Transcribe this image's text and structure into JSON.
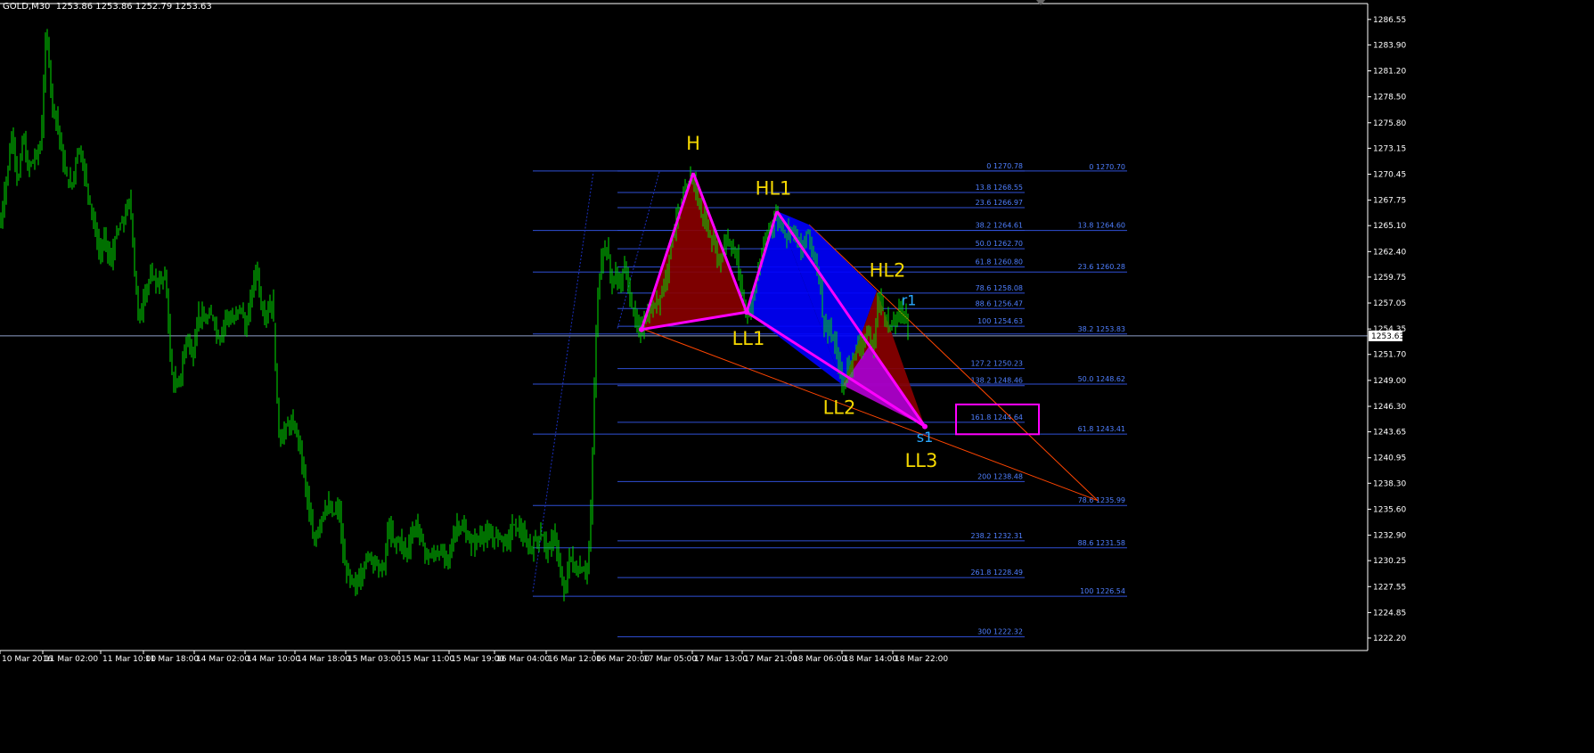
{
  "header": {
    "info": "GOLD,M30  1253.86 1253.86 1252.79 1253.63"
  },
  "colors": {
    "background": "#000000",
    "candle": "#00e000",
    "fib_line": "#2f4fd6",
    "fib_text": "#4f7fff",
    "pattern_line": "#ff00ff",
    "pattern_red": "#8b0000",
    "pattern_blue": "#0000ff",
    "label_yellow": "#f5d800",
    "label_cyan": "#2aa8ff",
    "trend_line": "#ff4500",
    "axis_text": "#ffffff"
  },
  "chart_data": {
    "type": "candlestick",
    "symbol": "GOLD",
    "timeframe": "M30",
    "current_price": "1253.63",
    "ylim": [
      1221.5,
      1288.5
    ],
    "y_ticks": [
      "1286.55",
      "1283.90",
      "1281.20",
      "1278.50",
      "1275.80",
      "1273.15",
      "1270.45",
      "1267.75",
      "1265.10",
      "1262.40",
      "1259.75",
      "1257.05",
      "1254.35",
      "1251.70",
      "1249.00",
      "1246.30",
      "1243.65",
      "1240.95",
      "1238.30",
      "1235.60",
      "1232.90",
      "1230.25",
      "1227.55",
      "1224.85",
      "1222.20"
    ],
    "x_ticks": [
      "10 Mar 2016",
      "11 Mar 02:00",
      "11 Mar 10:00",
      "11 Mar 18:00",
      "14 Mar 02:00",
      "14 Mar 10:00",
      "14 Mar 18:00",
      "15 Mar 03:00",
      "15 Mar 11:00",
      "15 Mar 19:00",
      "16 Mar 04:00",
      "16 Mar 12:00",
      "16 Mar 20:00",
      "17 Mar 05:00",
      "17 Mar 13:00",
      "17 Mar 21:00",
      "18 Mar 06:00",
      "18 Mar 14:00",
      "18 Mar 22:00"
    ],
    "price_path": [
      [
        0,
        1265.0
      ],
      [
        8,
        1270.5
      ],
      [
        14,
        1275.0
      ],
      [
        20,
        1269.0
      ],
      [
        26,
        1275.0
      ],
      [
        30,
        1271.0
      ],
      [
        38,
        1272.0
      ],
      [
        46,
        1273.5
      ],
      [
        52,
        1286.0
      ],
      [
        58,
        1278.0
      ],
      [
        64,
        1276.0
      ],
      [
        72,
        1271.0
      ],
      [
        80,
        1269.0
      ],
      [
        88,
        1273.5
      ],
      [
        94,
        1271.0
      ],
      [
        100,
        1268.0
      ],
      [
        106,
        1265.0
      ],
      [
        112,
        1262.0
      ],
      [
        118,
        1264.0
      ],
      [
        124,
        1261.0
      ],
      [
        130,
        1264.0
      ],
      [
        140,
        1266.0
      ],
      [
        146,
        1268.0
      ],
      [
        152,
        1259.0
      ],
      [
        156,
        1255.0
      ],
      [
        162,
        1258.0
      ],
      [
        170,
        1260.0
      ],
      [
        178,
        1259.0
      ],
      [
        186,
        1260.0
      ],
      [
        192,
        1250.0
      ],
      [
        198,
        1248.0
      ],
      [
        204,
        1250.0
      ],
      [
        210,
        1254.0
      ],
      [
        216,
        1251.0
      ],
      [
        222,
        1256.0
      ],
      [
        230,
        1255.0
      ],
      [
        238,
        1256.0
      ],
      [
        246,
        1253.0
      ],
      [
        254,
        1256.0
      ],
      [
        262,
        1255.0
      ],
      [
        270,
        1257.0
      ],
      [
        276,
        1254.0
      ],
      [
        282,
        1258.0
      ],
      [
        288,
        1261.0
      ],
      [
        294,
        1256.0
      ],
      [
        300,
        1256.0
      ],
      [
        306,
        1257.5
      ],
      [
        310,
        1248.0
      ],
      [
        314,
        1242.5
      ],
      [
        320,
        1244.0
      ],
      [
        326,
        1244.5
      ],
      [
        334,
        1243.5
      ],
      [
        340,
        1240.0
      ],
      [
        346,
        1236.0
      ],
      [
        352,
        1232.0
      ],
      [
        360,
        1234.5
      ],
      [
        366,
        1236.0
      ],
      [
        374,
        1235.0
      ],
      [
        380,
        1236.0
      ],
      [
        386,
        1230.0
      ],
      [
        392,
        1228.5
      ],
      [
        398,
        1227.5
      ],
      [
        406,
        1229.0
      ],
      [
        414,
        1231.0
      ],
      [
        422,
        1230.0
      ],
      [
        430,
        1229.0
      ],
      [
        436,
        1234.0
      ],
      [
        442,
        1232.0
      ],
      [
        448,
        1232.5
      ],
      [
        456,
        1231.0
      ],
      [
        462,
        1233.0
      ],
      [
        468,
        1234.0
      ],
      [
        474,
        1232.0
      ],
      [
        480,
        1230.5
      ],
      [
        488,
        1231.0
      ],
      [
        496,
        1231.0
      ],
      [
        504,
        1230.5
      ],
      [
        512,
        1234.0
      ],
      [
        520,
        1233.5
      ],
      [
        528,
        1232.0
      ],
      [
        536,
        1232.5
      ],
      [
        544,
        1233.0
      ],
      [
        552,
        1232.5
      ],
      [
        560,
        1233.0
      ],
      [
        568,
        1232.0
      ],
      [
        576,
        1234.0
      ],
      [
        584,
        1233.5
      ],
      [
        590,
        1232.0
      ],
      [
        596,
        1231.5
      ],
      [
        602,
        1232.5
      ],
      [
        608,
        1233.0
      ],
      [
        616,
        1231.0
      ],
      [
        622,
        1233.5
      ],
      [
        628,
        1229.0
      ],
      [
        634,
        1227.0
      ],
      [
        640,
        1231.0
      ],
      [
        646,
        1229.0
      ],
      [
        652,
        1229.5
      ],
      [
        658,
        1229.0
      ],
      [
        662,
        1232.0
      ],
      [
        666,
        1245.0
      ],
      [
        670,
        1257.0
      ],
      [
        674,
        1261.0
      ],
      [
        678,
        1263.0
      ],
      [
        682,
        1262.5
      ],
      [
        686,
        1259.0
      ],
      [
        690,
        1260.0
      ],
      [
        696,
        1259.0
      ],
      [
        702,
        1261.0
      ],
      [
        708,
        1257.0
      ],
      [
        714,
        1255.0
      ],
      [
        718,
        1254.0
      ],
      [
        724,
        1255.5
      ],
      [
        730,
        1256.0
      ],
      [
        736,
        1257.0
      ],
      [
        742,
        1258.0
      ],
      [
        748,
        1260.0
      ],
      [
        754,
        1264.0
      ],
      [
        760,
        1266.0
      ],
      [
        766,
        1268.0
      ],
      [
        772,
        1269.5
      ],
      [
        778,
        1270.5
      ],
      [
        784,
        1267.0
      ],
      [
        790,
        1266.0
      ],
      [
        796,
        1264.0
      ],
      [
        802,
        1263.0
      ],
      [
        808,
        1261.0
      ],
      [
        814,
        1264.0
      ],
      [
        820,
        1263.0
      ],
      [
        826,
        1262.0
      ],
      [
        832,
        1259.0
      ],
      [
        836,
        1256.0
      ],
      [
        840,
        1256.0
      ],
      [
        846,
        1258.0
      ],
      [
        852,
        1261.0
      ],
      [
        858,
        1263.0
      ],
      [
        864,
        1265.0
      ],
      [
        870,
        1266.0
      ],
      [
        876,
        1265.5
      ],
      [
        882,
        1264.0
      ],
      [
        888,
        1265.0
      ],
      [
        894,
        1264.0
      ],
      [
        900,
        1262.0
      ],
      [
        906,
        1265.0
      ],
      [
        912,
        1262.0
      ],
      [
        918,
        1261.0
      ],
      [
        924,
        1255.0
      ],
      [
        930,
        1254.0
      ],
      [
        936,
        1253.0
      ],
      [
        942,
        1250.5
      ],
      [
        946,
        1248.0
      ],
      [
        950,
        1250.0
      ],
      [
        956,
        1251.0
      ],
      [
        962,
        1252.5
      ],
      [
        968,
        1253.0
      ],
      [
        974,
        1254.0
      ],
      [
        980,
        1252.0
      ],
      [
        986,
        1258.0
      ],
      [
        992,
        1256.0
      ],
      [
        998,
        1254.5
      ],
      [
        1004,
        1255.0
      ],
      [
        1010,
        1256.5
      ],
      [
        1016,
        1256.0
      ],
      [
        1020,
        1254.0
      ]
    ],
    "fib_left": [
      {
        "label": "",
        "price": 1270.78
      },
      {
        "label": "",
        "price": 1264.6
      },
      {
        "label": "",
        "price": 1260.28
      },
      {
        "label": "",
        "price": 1253.83
      },
      {
        "label": "",
        "price": 1248.62
      },
      {
        "label": "",
        "price": 1243.41
      },
      {
        "label": "",
        "price": 1235.99
      },
      {
        "label": "",
        "price": 1231.58
      },
      {
        "label": "",
        "price": 1226.54
      }
    ],
    "fib_mid": [
      {
        "label": "0 1270.78",
        "price": 1270.78
      },
      {
        "label": "13.8 1268.55",
        "price": 1268.55
      },
      {
        "label": "23.6 1266.97",
        "price": 1266.97
      },
      {
        "label": "38.2 1264.61",
        "price": 1264.61
      },
      {
        "label": "50.0 1262.70",
        "price": 1262.7
      },
      {
        "label": "61.8 1260.80",
        "price": 1260.8
      },
      {
        "label": "78.6 1258.08",
        "price": 1258.08
      },
      {
        "label": "88.6 1256.47",
        "price": 1256.47
      },
      {
        "label": "100 1254.63",
        "price": 1254.63
      },
      {
        "label": "127.2 1250.23",
        "price": 1250.23
      },
      {
        "label": "138.2 1248.46",
        "price": 1248.46
      },
      {
        "label": "161.8 1244.64",
        "price": 1244.64
      },
      {
        "label": "200 1238.48",
        "price": 1238.48
      },
      {
        "label": "238.2 1232.31",
        "price": 1232.31
      },
      {
        "label": "261.8 1228.49",
        "price": 1228.49
      },
      {
        "label": "300 1222.32",
        "price": 1222.32
      }
    ],
    "fib_right": [
      {
        "label": "0 1270.70",
        "price": 1270.7
      },
      {
        "label": "13.8 1264.60",
        "price": 1264.6
      },
      {
        "label": "23.6 1260.28",
        "price": 1260.28
      },
      {
        "label": "38.2 1253.83",
        "price": 1253.83
      },
      {
        "label": "50.0 1248.62",
        "price": 1248.62
      },
      {
        "label": "61.8 1243.41",
        "price": 1243.41
      },
      {
        "label": "78.6 1235.99",
        "price": 1235.99
      },
      {
        "label": "88.6 1231.58",
        "price": 1231.58
      },
      {
        "label": "100 1226.54",
        "price": 1226.54
      }
    ],
    "pattern_points": {
      "X": [
        720,
        1254.3
      ],
      "H": [
        778,
        1270.6
      ],
      "LL1": [
        838,
        1256.1
      ],
      "HL1": [
        872,
        1266.6
      ],
      "T": [
        908,
        1265.2
      ],
      "HL2": [
        984,
        1258.3
      ],
      "LL2": [
        946,
        1248.5
      ],
      "S": [
        1038,
        1244.2
      ]
    },
    "labels": [
      {
        "text": "H",
        "px": 778,
        "price": 1273.0,
        "color": "yellow"
      },
      {
        "text": "HL1",
        "px": 868,
        "price": 1268.3,
        "color": "yellow"
      },
      {
        "text": "HL2",
        "px": 996,
        "price": 1259.8,
        "color": "yellow"
      },
      {
        "text": "r1",
        "px": 1020,
        "price": 1256.8,
        "color": "cyan"
      },
      {
        "text": "LL1",
        "px": 840,
        "price": 1252.7,
        "color": "yellow"
      },
      {
        "text": "LL2",
        "px": 942,
        "price": 1245.5,
        "color": "yellow"
      },
      {
        "text": "s1",
        "px": 1038,
        "price": 1242.6,
        "color": "cyan"
      },
      {
        "text": "LL3",
        "px": 1034,
        "price": 1240.0,
        "color": "yellow"
      }
    ]
  }
}
